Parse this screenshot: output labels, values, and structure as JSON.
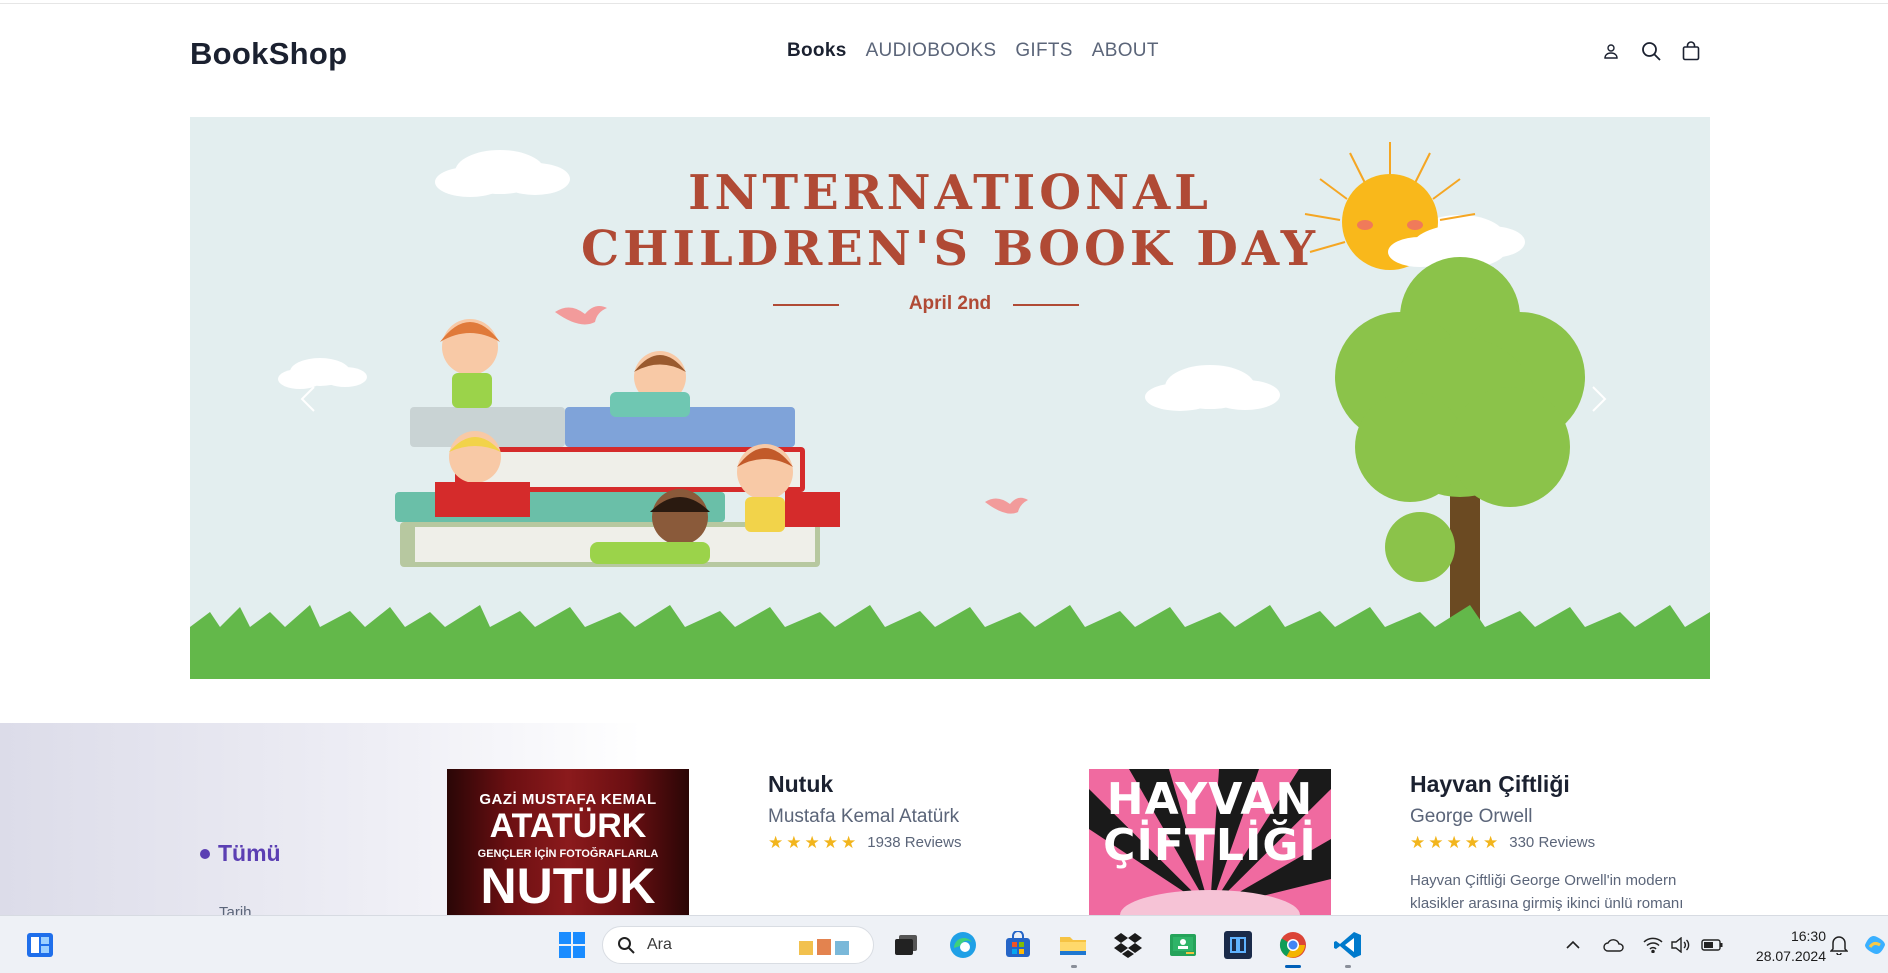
{
  "header": {
    "logo": "BookShop",
    "nav": [
      {
        "label": "Books",
        "active": true
      },
      {
        "label": "AUDIOBOOKS",
        "active": false
      },
      {
        "label": "GIFTS",
        "active": false
      },
      {
        "label": "ABOUT",
        "active": false
      }
    ],
    "icons": [
      "user-icon",
      "search-icon",
      "shopping-bag-icon"
    ]
  },
  "banner": {
    "title_line1": "INTERNATIONAL",
    "title_line2": "CHILDREN'S BOOK DAY",
    "date": "April 2nd",
    "prev_icon": "chevron-left-icon",
    "next_icon": "chevron-right-icon"
  },
  "categories": {
    "active": "Tümü",
    "next": "Tarih"
  },
  "books": [
    {
      "title": "Nutuk",
      "author": "Mustafa Kemal Atatürk",
      "stars": 5,
      "reviews": "1938 Reviews",
      "cover": {
        "line1": "GAZİ MUSTAFA KEMAL",
        "line2": "ATATÜRK",
        "line3": "GENÇLER İÇİN FOTOĞRAFLARLA",
        "line4": "NUTUK"
      }
    },
    {
      "title": "Hayvan Çiftliği",
      "author": "George Orwell",
      "stars": 5,
      "reviews": "330 Reviews",
      "description": "Hayvan Çiftliği George Orwell'in modern klasikler arasına girmiş ikinci ünlü romanı",
      "cover": {
        "line1": "HAYVAN",
        "line2": "ÇİFTLİĞİ"
      }
    }
  ],
  "colors": {
    "accent": "#5b3fb3",
    "star": "#f2b51d",
    "banner_title": "#b04a35"
  },
  "taskbar": {
    "search_placeholder": "Ara",
    "apps": [
      "windows-start-icon",
      "task-view-icon",
      "edge-icon",
      "store-icon",
      "file-explorer-icon",
      "dropbox-icon",
      "classroom-icon",
      "app-icon",
      "chrome-icon",
      "vscode-icon"
    ],
    "time": "16:30",
    "date": "28.07.2024"
  }
}
